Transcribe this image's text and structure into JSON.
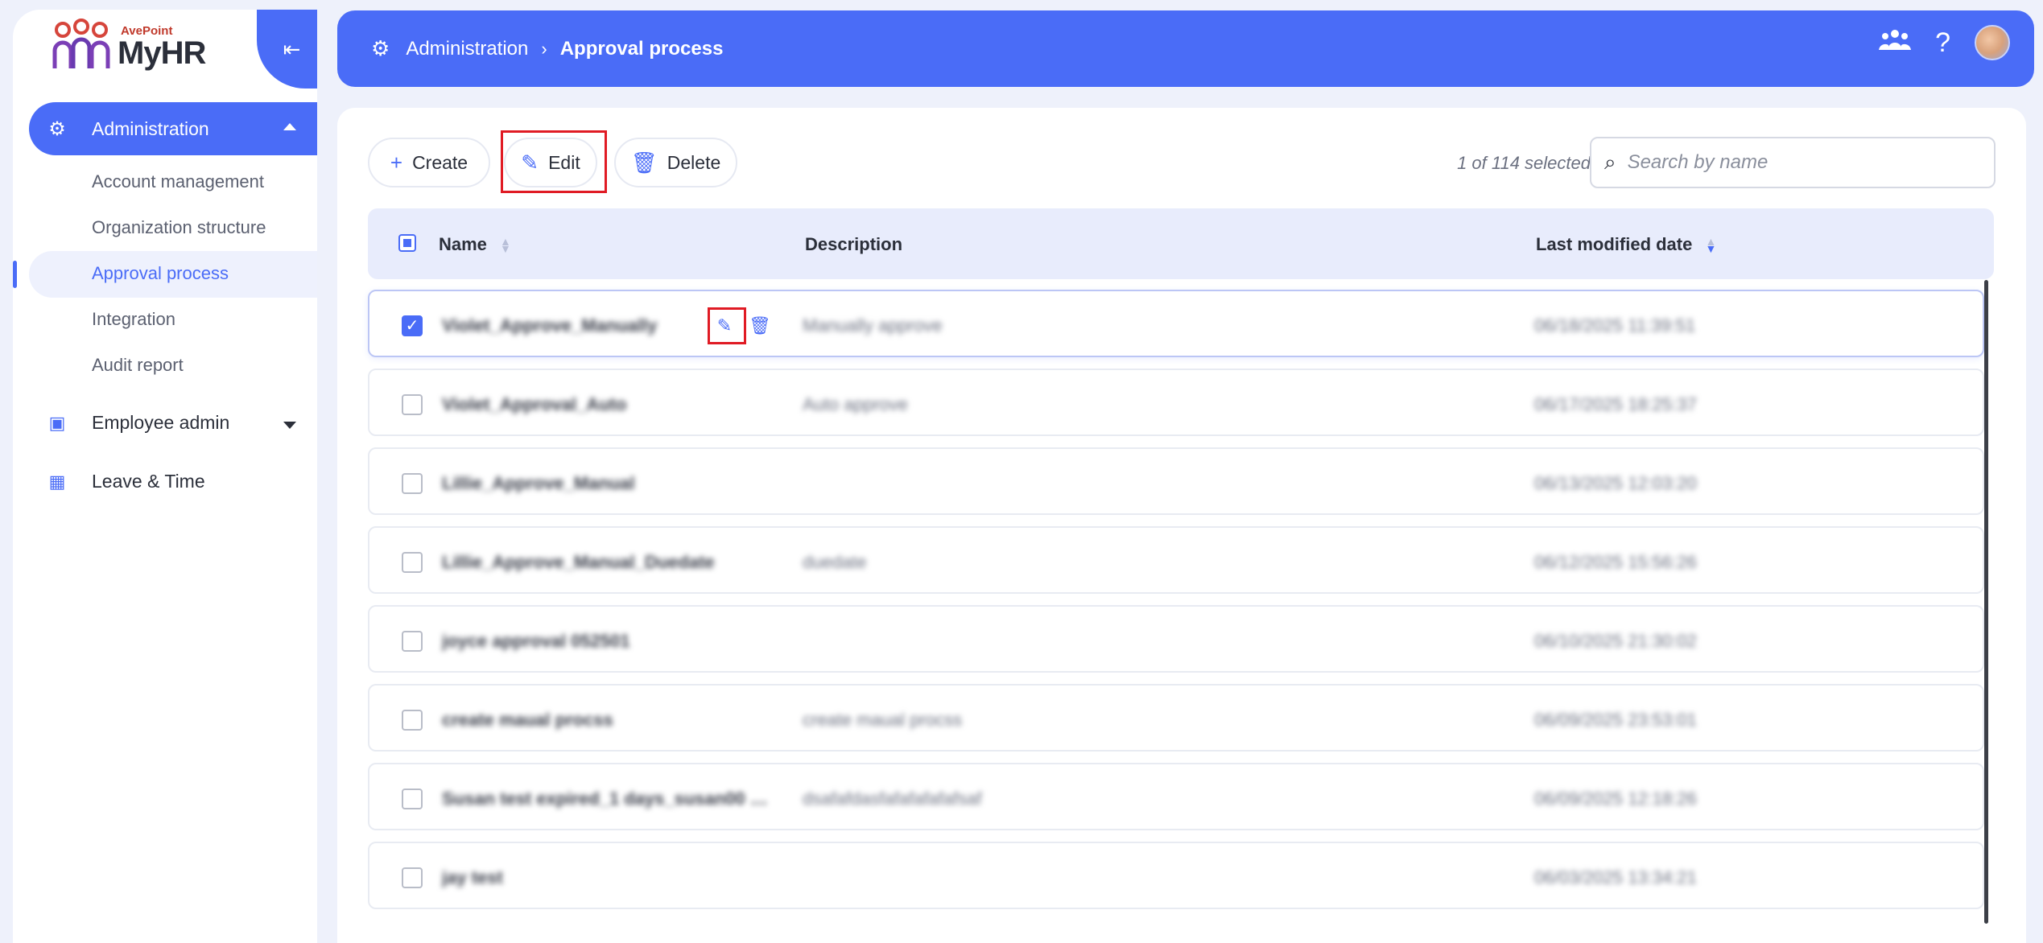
{
  "app": {
    "brand": "AvePoint",
    "name": "MyHR"
  },
  "sidebar": {
    "admin_label": "Administration",
    "admin_items": [
      {
        "label": "Account management"
      },
      {
        "label": "Organization structure"
      },
      {
        "label": "Approval process"
      },
      {
        "label": "Integration"
      },
      {
        "label": "Audit report"
      }
    ],
    "groups": [
      {
        "label": "Employee admin"
      },
      {
        "label": "Leave & Time"
      }
    ]
  },
  "header": {
    "breadcrumb_root": "Administration",
    "breadcrumb_current": "Approval process",
    "icons": [
      "team-icon",
      "help-icon",
      "avatar"
    ]
  },
  "toolbar": {
    "create_label": "Create",
    "edit_label": "Edit",
    "delete_label": "Delete",
    "selection_text": "1 of 114 selected",
    "search_placeholder": "Search by name"
  },
  "table": {
    "columns": {
      "name": "Name",
      "description": "Description",
      "modified": "Last modified date"
    },
    "rows": [
      {
        "name": "Violet_Approve_Manually",
        "description": "Manually approve",
        "modified": "06/18/2025 11:39:51",
        "selected": true
      },
      {
        "name": "Violet_Approval_Auto",
        "description": "Auto approve",
        "modified": "06/17/2025 18:25:37",
        "selected": false
      },
      {
        "name": "Lillie_Approve_Manual",
        "description": "",
        "modified": "06/13/2025 12:03:20",
        "selected": false
      },
      {
        "name": "Lillie_Approve_Manual_Duedate",
        "description": "duedate",
        "modified": "06/12/2025 15:56:26",
        "selected": false
      },
      {
        "name": "joyce approval 052501",
        "description": "",
        "modified": "06/10/2025 21:30:02",
        "selected": false
      },
      {
        "name": "create maual procss",
        "description": "create maual procss",
        "modified": "06/09/2025 23:53:01",
        "selected": false
      },
      {
        "name": "Susan test expired_1 days_susan00 a...",
        "description": "dsafafdasfafafafafafsaf",
        "modified": "06/09/2025 12:18:26",
        "selected": false
      },
      {
        "name": "jay test",
        "description": "",
        "modified": "06/03/2025 13:34:21",
        "selected": false
      }
    ]
  },
  "colors": {
    "accent": "#4a6cf7",
    "highlight": "#e01b24",
    "header_row_bg": "#e8ecfc"
  }
}
